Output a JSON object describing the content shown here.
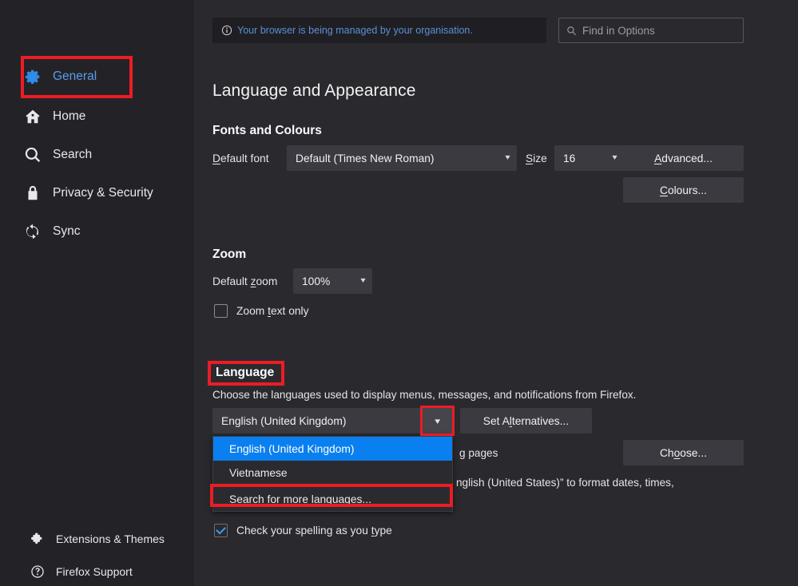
{
  "sidebar": {
    "items": [
      {
        "label": "General",
        "icon": "gear-icon",
        "selected": true
      },
      {
        "label": "Home",
        "icon": "home-icon",
        "selected": false
      },
      {
        "label": "Search",
        "icon": "search-icon",
        "selected": false
      },
      {
        "label": "Privacy & Security",
        "icon": "lock-icon",
        "selected": false
      },
      {
        "label": "Sync",
        "icon": "sync-icon",
        "selected": false
      }
    ],
    "bottom_items": [
      {
        "label": "Extensions & Themes",
        "icon": "puzzle-icon"
      },
      {
        "label": "Firefox Support",
        "icon": "help-circle-icon"
      }
    ]
  },
  "notice": {
    "icon": "info-circle-icon",
    "text": "Your browser is being managed by your organisation.",
    "color": "#5b8fd4"
  },
  "search": {
    "icon": "search-icon",
    "placeholder": "Find in Options"
  },
  "main": {
    "page_title": "Language and Appearance",
    "fonts": {
      "heading": "Fonts and Colours",
      "default_font_label": "Default font",
      "default_font_value": "Default (Times New Roman)",
      "size_label": "Size",
      "size_value": "16",
      "advanced_button": "Advanced...",
      "colours_button": "Colours..."
    },
    "zoom": {
      "heading": "Zoom",
      "default_zoom_label": "Default zoom",
      "default_zoom_value": "100%",
      "zoom_text_only_label": "Zoom text only",
      "zoom_text_only_checked": false
    },
    "language": {
      "heading": "Language",
      "description": "Choose the languages used to display menus, messages, and notifications from Firefox.",
      "selected_language": "English (United Kingdom)",
      "chevron": "chevron-down-icon",
      "set_alternatives_button": "Set Alternatives...",
      "dropdown_options": [
        {
          "label": "English (United Kingdom)",
          "active": true
        },
        {
          "label": "Vietnamese",
          "active": false
        },
        {
          "label": "Search for more languages...",
          "active": false
        }
      ],
      "obscured_line_1": "g pages",
      "obscured_line_2": "nglish (United States)” to format dates, times,",
      "choose_button": "Choose...",
      "spellcheck_label": "Check your spelling as you type",
      "spellcheck_checked": true
    }
  },
  "annotations": {
    "color": "#ed1c24",
    "boxes": [
      "general-nav-item",
      "language-heading",
      "language-dropdown-chevron",
      "search-more-languages-option"
    ]
  }
}
